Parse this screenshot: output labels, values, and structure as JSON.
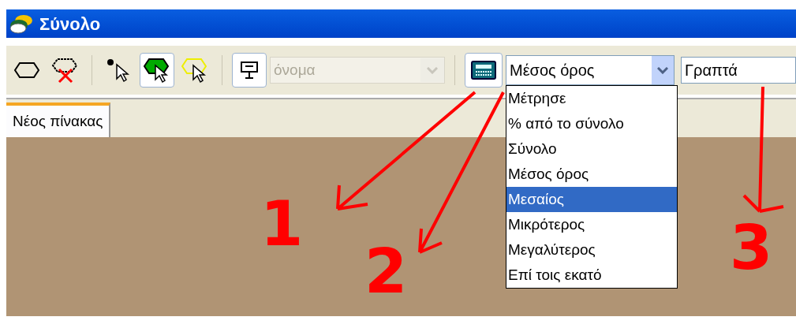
{
  "window": {
    "title": "Σύνολο"
  },
  "toolbar": {
    "shape_tools": [
      {
        "kind": "ellipse",
        "selected": false
      },
      {
        "kind": "delete-ellipse",
        "selected": false
      }
    ],
    "pointer_tools": [
      {
        "kind": "dot",
        "selected": false
      },
      {
        "kind": "green",
        "selected": true
      },
      {
        "kind": "yellow",
        "selected": false
      }
    ],
    "name_combo": {
      "value": "όνομα",
      "disabled": true
    },
    "aggregate_combo": {
      "value": "Μέσος όρος",
      "expanded": true,
      "options": [
        {
          "label": "Μέτρησε",
          "highlighted": false
        },
        {
          "label": "% από το σύνολο",
          "highlighted": false
        },
        {
          "label": "Σύνολο",
          "highlighted": false
        },
        {
          "label": "Μέσος όρος",
          "highlighted": false
        },
        {
          "label": "Μεσαίος",
          "highlighted": true
        },
        {
          "label": "Μικρότερος",
          "highlighted": false
        },
        {
          "label": "Μεγαλύτερος",
          "highlighted": false
        },
        {
          "label": "Επί τοις εκατό",
          "highlighted": false
        }
      ]
    },
    "field": {
      "value": "Γραπτά"
    }
  },
  "tabs": [
    {
      "label": "Νέος πίνακας",
      "selected": true
    }
  ],
  "annotations": [
    "1",
    "2",
    "3"
  ]
}
